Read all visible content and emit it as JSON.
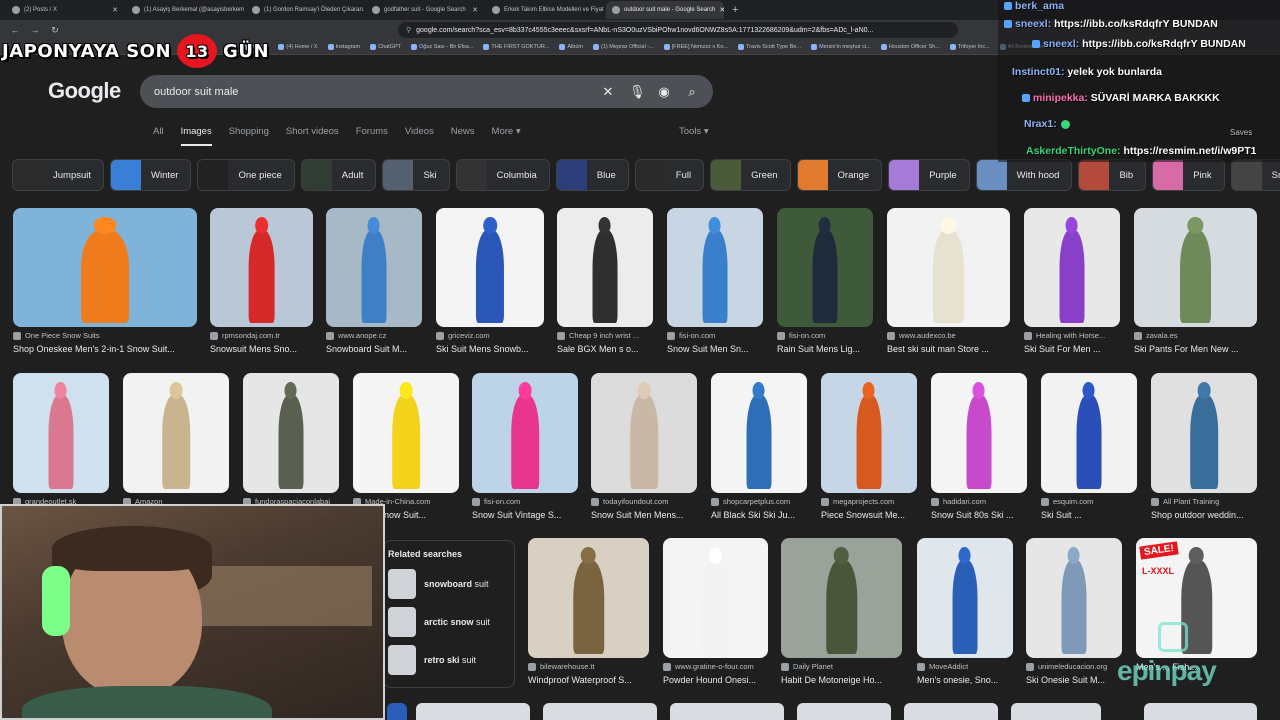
{
  "browser": {
    "tabs": [
      {
        "title": "(2) Posts / X",
        "active": false
      },
      {
        "title": "(1) Asayiş Berkemal (@asayisberkem...",
        "active": false
      },
      {
        "title": "(1) Gordon Ramsay'i Öleden Çıkaran...",
        "active": false
      },
      {
        "title": "godfather suit - Google Search",
        "active": false
      },
      {
        "title": "Erkek Takım Elbise Modelleri ve Fiyatları",
        "active": false
      },
      {
        "title": "outdoor suit male - Google Search",
        "active": true
      }
    ],
    "url": "google.com/search?sca_esv=8b337c4555c3eeec&sxsrf=ANbL-nS3O0uzVSbiPOhw1novd6ONWZ8s5A:1771322686209&udm=2&fbs=ADc_l-aN0...",
    "bookmarks": [
      "uTube",
      "(4) Home / X",
      "Instagram",
      "ChatGPT",
      "Oğuz Sası - Bir Efsa...",
      "THE FIRST GOKTUR...",
      "Albüm",
      "(1) Mepraz Official -...",
      "[FREE] Nemzzz x Ko...",
      "Travis Scott Type Be...",
      "Mersin'in meşhur ci...",
      "Houston Officer Sh...",
      "Trifoyer Inc...",
      "All Bookmarks"
    ]
  },
  "google": {
    "logo": "Google",
    "query": "outdoor suit male",
    "filters": [
      "All",
      "Images",
      "Shopping",
      "Short videos",
      "Forums",
      "Videos",
      "News",
      "More ▾"
    ],
    "active_filter": "Images",
    "tools": "Tools ▾",
    "chips": [
      {
        "label": "Jumpsuit",
        "color": "#2b2b2b"
      },
      {
        "label": "Winter",
        "color": "#3a7fd6"
      },
      {
        "label": "One piece",
        "color": "#222"
      },
      {
        "label": "Adult",
        "color": "#2f3d35"
      },
      {
        "label": "Ski",
        "color": "#556070"
      },
      {
        "label": "Columbia",
        "color": "#333"
      },
      {
        "label": "Blue",
        "color": "#2d3f7a"
      },
      {
        "label": "Full",
        "color": "#2a2a2a"
      },
      {
        "label": "Green",
        "color": "#4a5b3a"
      },
      {
        "label": "Orange",
        "color": "#e07a2e"
      },
      {
        "label": "Purple",
        "color": "#a47bd6"
      },
      {
        "label": "With hood",
        "color": "#6a8fc2"
      },
      {
        "label": "Bib",
        "color": "#b44a3a"
      },
      {
        "label": "Pink",
        "color": "#d96aa8"
      },
      {
        "label": "Snowbo",
        "color": "#444"
      }
    ],
    "row1": [
      {
        "source": "One Piece Snow Suits",
        "title": "Shop Oneskee Men's 2-in-1 Snow Suit...",
        "bg": "#7fb3d9",
        "fig": "#f07b1d"
      },
      {
        "source": "rpmsondaj.com.tr",
        "title": "Snowsuit Mens Sno...",
        "bg": "#b9c7d6",
        "fig": "#d62a2a"
      },
      {
        "source": "www.anope.cz",
        "title": "Snowboard Suit M...",
        "bg": "#a7b8c6",
        "fig": "#3e7fc6"
      },
      {
        "source": "griceviz.com",
        "title": "Ski Suit Mens Snowb...",
        "bg": "#f4f4f4",
        "fig": "#2a56b8"
      },
      {
        "source": "Cheap 9 inch wrist ...",
        "title": "Sale BGX Men s o...",
        "bg": "#ececec",
        "fig": "#2f2f2f"
      },
      {
        "source": "fisi-on.com",
        "title": "Snow Suit Men Sn...",
        "bg": "#c8d6e4",
        "fig": "#3a7fc9"
      },
      {
        "source": "fisi-on.com",
        "title": "Rain Suit Mens Lig...",
        "bg": "#3e5a3a",
        "fig": "#1f2a3a"
      },
      {
        "source": "www.audexco.be",
        "title": "Best ski suit man Store ...",
        "bg": "#f2f2f2",
        "fig": "#e7e1d0"
      },
      {
        "source": "Healing with Horse...",
        "title": "Ski Suit For Men ...",
        "bg": "#e8e8e8",
        "fig": "#8a3fc9"
      },
      {
        "source": "zavala.es",
        "title": "Ski Pants For Men New ...",
        "bg": "#d6dbe0",
        "fig": "#6f8a5a"
      }
    ],
    "row2": [
      {
        "source": "grandeoutlet.sk",
        "title": "",
        "bg": "#cfe0ee",
        "fig": "#d9788f"
      },
      {
        "source": "Amazon",
        "title": "",
        "bg": "#f2f2f2",
        "fig": "#c9b48f"
      },
      {
        "source": "fundoraspaciaconlabai",
        "title": "",
        "bg": "#e6e6e6",
        "fig": "#5a6050"
      },
      {
        "source": "Made-in-China.com",
        "title": "Piece Snow Suit...",
        "bg": "#f4f4f4",
        "fig": "#f2d21a"
      },
      {
        "source": "fisi-on.com",
        "title": "Snow Suit Vintage S...",
        "bg": "#bcd3e8",
        "fig": "#e8368f"
      },
      {
        "source": "todayifoundout.com",
        "title": "Snow Suit Men Mens...",
        "bg": "#dcdcdc",
        "fig": "#c9b8a6"
      },
      {
        "source": "shopcarpetplus.com",
        "title": "All Black Ski Ski Ju...",
        "bg": "#f4f4f4",
        "fig": "#2f6fb8"
      },
      {
        "source": "megaprojects.com",
        "title": "Piece Snowsuit Me...",
        "bg": "#c7d6e6",
        "fig": "#d65a1f"
      },
      {
        "source": "hadidari.com",
        "title": "Snow Suit 80s Ski ...",
        "bg": "#f4f4f4",
        "fig": "#c64ac9"
      },
      {
        "source": "esquim.com",
        "title": "Ski Suit ...",
        "bg": "#f2f2f2",
        "fig": "#2a4fb8"
      },
      {
        "source": "All Plant Training",
        "title": "Shop outdoor weddin...",
        "bg": "#e0e0e0",
        "fig": "#3a6e9a"
      }
    ],
    "row3": [
      {
        "source": "bilewarehouse.tt",
        "title": "Windproof Waterproof S...",
        "bg": "#d9d0c4",
        "fig": "#7a6440"
      },
      {
        "source": "www.gratine-o-four.com",
        "title": "Powder Hound Onesi...",
        "bg": "#f4f4f4",
        "fig": "#f2f2f2"
      },
      {
        "source": "Daily Planet",
        "title": "Habit De Motoneige Ho...",
        "bg": "#9aa39a",
        "fig": "#4a553a"
      },
      {
        "source": "MoveAddict",
        "title": "Men's onesie, Sno...",
        "bg": "#dfe6ec",
        "fig": "#2a5fb8"
      },
      {
        "source": "unimeleducacion.org",
        "title": "Ski Onesie Suit M...",
        "bg": "#e6e6e6",
        "fig": "#7f9ab8"
      },
      {
        "source": "",
        "title": "Men's ... Fish...",
        "bg": "#f4f4f4",
        "fig": "#555",
        "badge": "SALE!",
        "size": "L-XXXL"
      }
    ],
    "related": {
      "heading": "Related searches",
      "items": [
        {
          "prefix": "snowboard",
          "suffix": " suit"
        },
        {
          "prefix": "arctic snow",
          "suffix": " suit"
        },
        {
          "prefix": "retro ski",
          "suffix": " suit"
        }
      ]
    }
  },
  "stream": {
    "banner_prefix": "JAPONYAYA SON",
    "banner_num": "13",
    "banner_suffix": "GÜN",
    "chat": [
      {
        "user": "berk_ama",
        "text": "",
        "color": "blue"
      },
      {
        "user": "sneexl:",
        "text": " https://ibb.co/ksRdqfrY BUNDAN",
        "color": "blue"
      },
      {
        "user": "sneexl:",
        "text": " https://ibb.co/ksRdqfrY BUNDAN",
        "color": "blue"
      },
      {
        "user": "Instinct01:",
        "text": " yelek yok bunlarda",
        "color": "blue"
      },
      {
        "user": "minipekka:",
        "text": " SÜVARİ MARKA BAKKKK",
        "color": "pink"
      },
      {
        "user": "Nrax1:",
        "text": "",
        "color": "blue"
      },
      {
        "user": "AskerdeThirtyOne:",
        "text": " https://resmim.net/i/w9PT1",
        "color": "green"
      }
    ],
    "saves": "Saves",
    "watermark": "epinpay"
  }
}
